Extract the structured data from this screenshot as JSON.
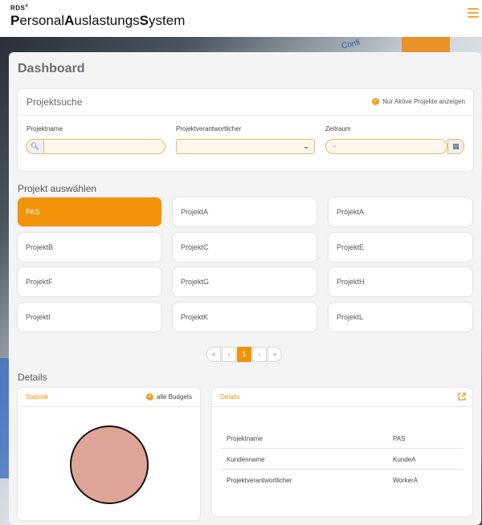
{
  "header": {
    "brand_small": "RDS",
    "brand_parts": [
      {
        "b": "P",
        "t": "ersonal"
      },
      {
        "b": "A",
        "t": "uslastungs"
      },
      {
        "b": "S",
        "t": "ystem"
      }
    ]
  },
  "background": {
    "partial_text": "Confi"
  },
  "dashboard": {
    "title": "Dashboard"
  },
  "search": {
    "title": "Projektsuche",
    "active_only_label": "Nur Aktive Projekte anzeigen",
    "project_name_label": "Projektname",
    "project_name_value": "",
    "responsible_label": "Projektverantwortlicher",
    "responsible_value": "",
    "period_label": "Zeitraum",
    "period_value": "-"
  },
  "projects": {
    "section_label": "Projekt auswählen",
    "items": [
      "PAS",
      "ProjektA",
      "ProjektA",
      "ProjektB",
      "ProjektC",
      "ProjektE",
      "ProjektF",
      "ProjektG",
      "ProjektH",
      "ProjektI",
      "ProjektK",
      "ProjektL"
    ],
    "selected_index": 0
  },
  "pagination": {
    "first": "«",
    "prev": "‹",
    "current": "1",
    "next": "›",
    "last": "»"
  },
  "details": {
    "section_label": "Details",
    "statistik": {
      "title": "Statistik",
      "budgets_label": "alle Budgets"
    },
    "info": {
      "title": "Details",
      "rows": [
        {
          "key": "Projektname",
          "value": "PAS"
        },
        {
          "key": "Kundenname",
          "value": "KundeA"
        },
        {
          "key": "Projektverantwortlicher",
          "value": "WorkerA"
        }
      ]
    }
  },
  "colors": {
    "accent": "#f0930a",
    "pie_fill": "#dea498"
  }
}
